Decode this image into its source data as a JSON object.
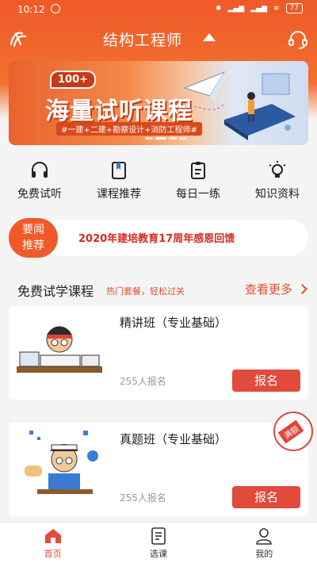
{
  "status": {
    "time": "10:12",
    "battery": "77"
  },
  "header": {
    "title": "结构工程师"
  },
  "banner": {
    "badge": "100+",
    "title": "海量试听课程",
    "subtitle": "#一建+二建+勘察设计+消防工程师#"
  },
  "quicknav": [
    {
      "label": "免费试听",
      "icon": "headphones-icon"
    },
    {
      "label": "课程推荐",
      "icon": "bookmark-book-icon"
    },
    {
      "label": "每日一练",
      "icon": "clipboard-icon"
    },
    {
      "label": "知识资料",
      "icon": "lightbulb-icon"
    }
  ],
  "news": {
    "badge_line1": "要闻",
    "badge_line2": "推荐",
    "text": "2020年建培教育17周年感恩回馈"
  },
  "section": {
    "title": "免费试学课程",
    "subtitle": "热门套餐，轻松过关",
    "more": "查看更多"
  },
  "courses": [
    {
      "title": "精讲班（专业基础）",
      "count": "255人报名",
      "button": "报名",
      "full": false
    },
    {
      "title": "真题班（专业基础）",
      "count": "255人报名",
      "button": "报名",
      "full": true,
      "stamp": "满额"
    }
  ],
  "tabs": [
    {
      "label": "首页",
      "icon": "home-icon",
      "active": true
    },
    {
      "label": "选课",
      "icon": "course-list-icon",
      "active": false
    },
    {
      "label": "我的",
      "icon": "user-icon",
      "active": false
    }
  ],
  "colors": {
    "brand": "#ef5a28",
    "accent_red": "#e24a3c"
  }
}
